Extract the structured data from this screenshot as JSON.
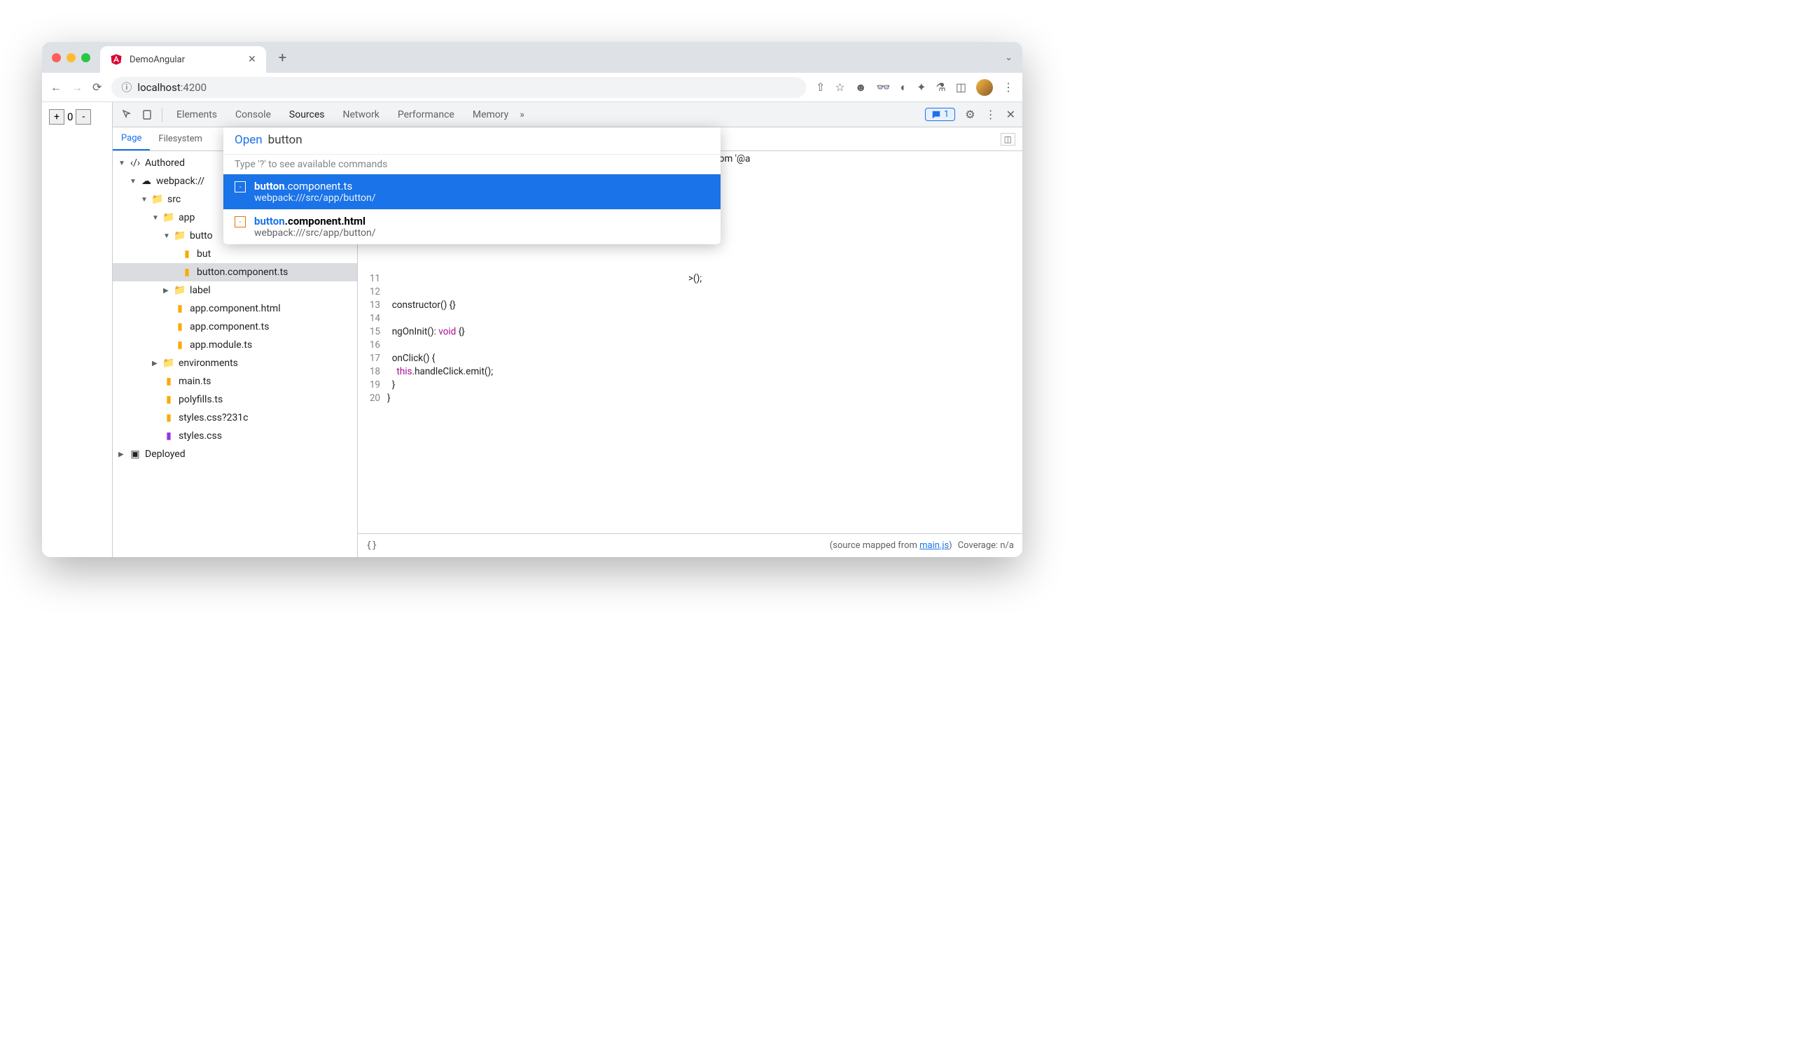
{
  "tab": {
    "title": "DemoAngular"
  },
  "url": {
    "host": "localhost",
    "port": ":4200"
  },
  "page": {
    "counter": {
      "plus": "+",
      "value": "0",
      "minus": "-"
    }
  },
  "devtools": {
    "tabs": [
      "Elements",
      "Console",
      "Sources",
      "Network",
      "Performance",
      "Memory"
    ],
    "active_tab": "Sources",
    "msg_count": "1"
  },
  "sidebar": {
    "tabs": [
      "Page",
      "Filesystem"
    ],
    "tree": {
      "authored": "Authored",
      "webpack": "webpack://",
      "src": "src",
      "app": "app",
      "button": "butto",
      "button_html": "but",
      "button_ts": "button.component.ts",
      "label": "label",
      "app_html": "app.component.html",
      "app_ts": "app.component.ts",
      "app_module": "app.module.ts",
      "environments": "environments",
      "main_ts": "main.ts",
      "polyfills": "polyfills.ts",
      "styles_q": "styles.css?231c",
      "styles": "styles.css",
      "deployed": "Deployed"
    }
  },
  "palette": {
    "open_label": "Open",
    "query": "button",
    "hint": "Type '?' to see available commands",
    "items": [
      {
        "match": "button",
        "rest": ".component.ts",
        "path": "webpack:///src/app/button/"
      },
      {
        "match": "button",
        "rest": ".component.html",
        "path": "webpack:///src/app/button/"
      }
    ]
  },
  "editor": {
    "partial_line": "Emitter } from '@a",
    "line10": ">();",
    "line12": "constructor() {}",
    "line14_a": "ngOnInit(): ",
    "line14_b": "void",
    "line14_c": " {}",
    "line16": "onClick() {",
    "line17_a": "this",
    "line17_b": ".handleClick.emit();",
    "line18": "}",
    "line19": "}",
    "line_numbers": [
      "11",
      "12",
      "13",
      "14",
      "15",
      "16",
      "17",
      "18",
      "19",
      "20"
    ]
  },
  "footer": {
    "braces": "{}",
    "mapped_prefix": "(source mapped from ",
    "mapped_link": "main.js",
    "mapped_suffix": ")",
    "coverage": "Coverage: n/a"
  }
}
